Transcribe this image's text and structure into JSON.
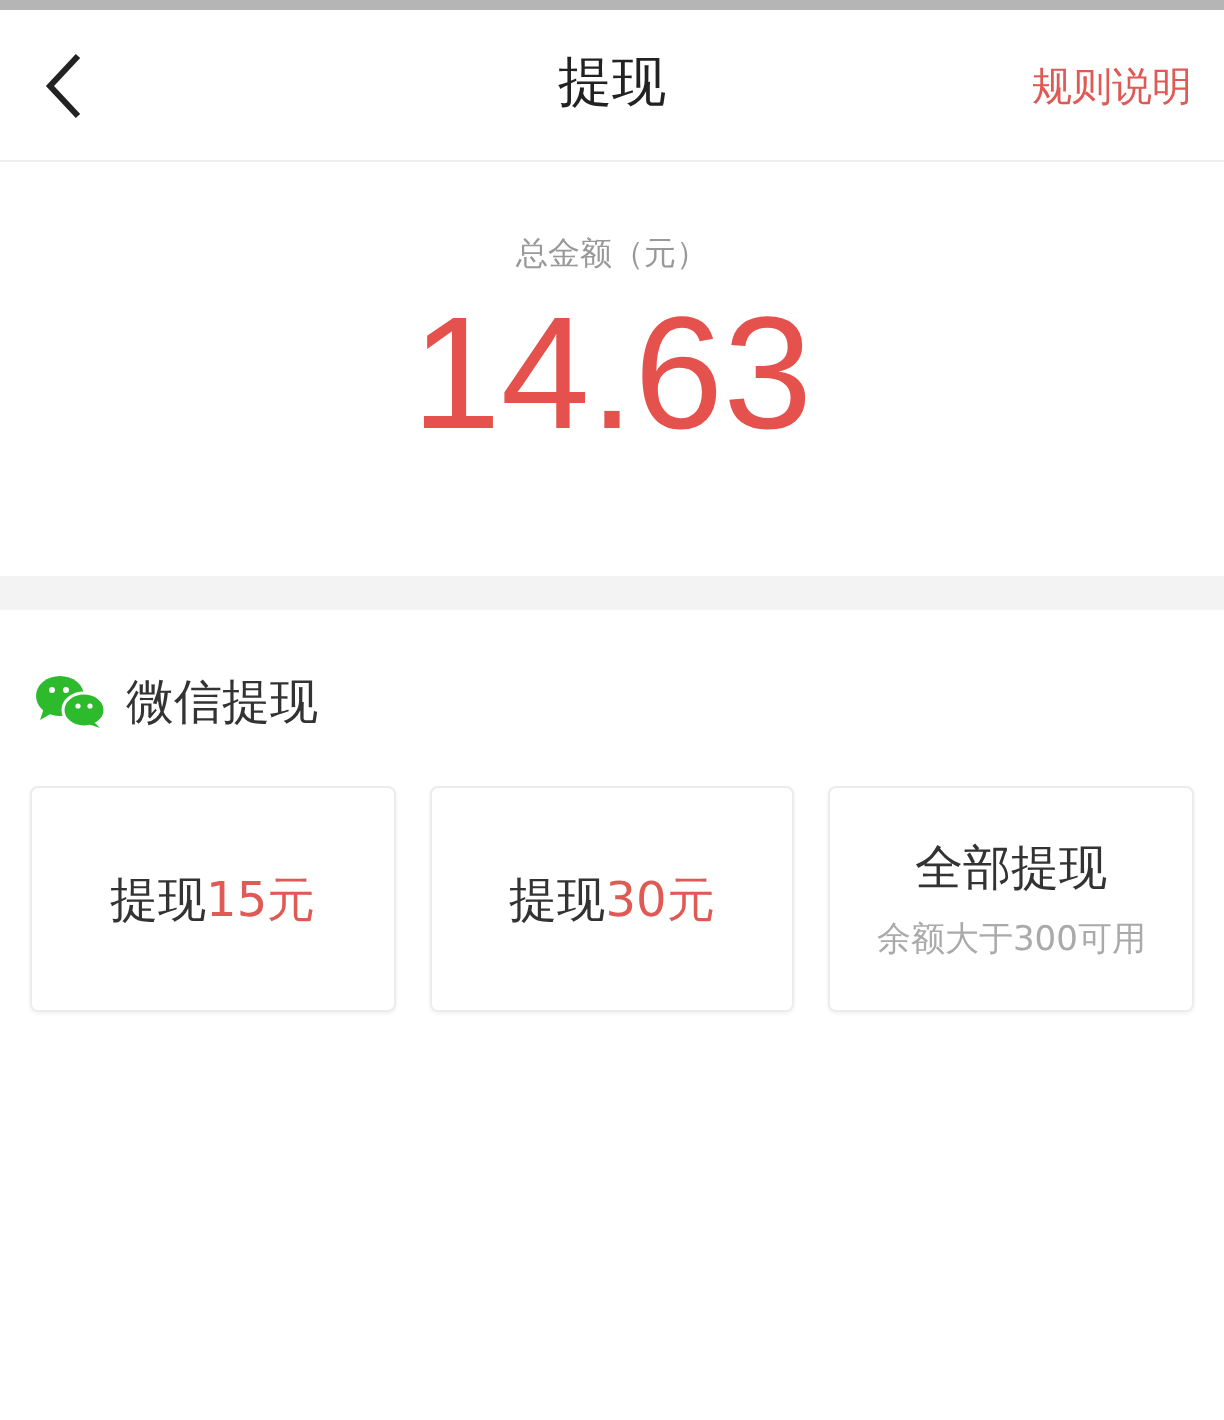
{
  "header": {
    "title": "提现",
    "action": "规则说明"
  },
  "balance": {
    "label": "总金额（元）",
    "amount": "14.63"
  },
  "wechat": {
    "title": "微信提现",
    "options": [
      {
        "kind": "amount",
        "label": "提现",
        "amount": "15元"
      },
      {
        "kind": "amount",
        "label": "提现",
        "amount": "30元"
      },
      {
        "kind": "all",
        "label": "全部提现",
        "note": "余额大于300可用"
      }
    ]
  }
}
